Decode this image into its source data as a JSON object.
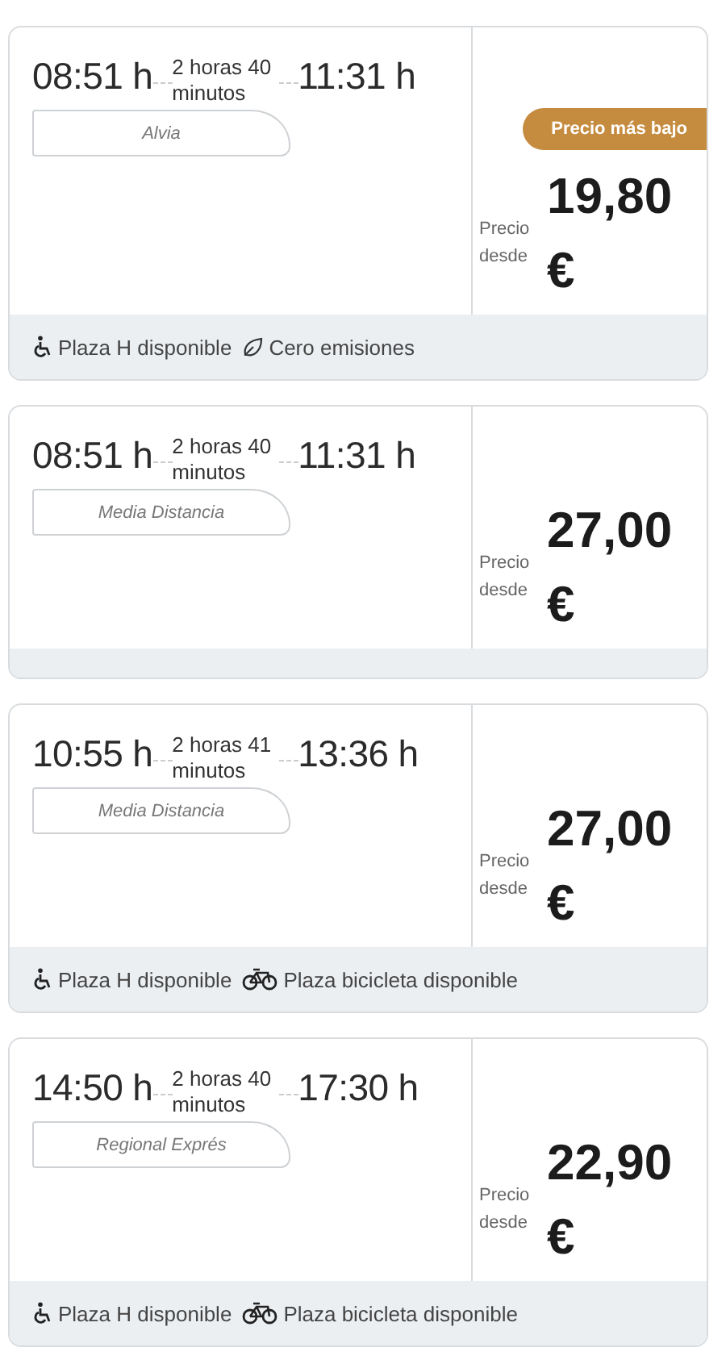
{
  "trips": [
    {
      "departure": "08:51 h",
      "duration": "2 horas 40 minutos",
      "arrival": "11:31 h",
      "train": "Alvia",
      "badge": "Precio más bajo",
      "price_label": "Precio desde",
      "price": "19,80 €",
      "features": [
        {
          "kind": "wheelchair",
          "label": "Plaza H disponible"
        },
        {
          "kind": "leaf",
          "label": "Cero emisiones"
        }
      ]
    },
    {
      "departure": "08:51 h",
      "duration": "2 horas 40 minutos",
      "arrival": "11:31 h",
      "train": "Media Distancia",
      "price_label": "Precio desde",
      "price": "27,00 €"
    },
    {
      "departure": "10:55 h",
      "duration": "2 horas 41 minutos",
      "arrival": "13:36 h",
      "train": "Media Distancia",
      "price_label": "Precio desde",
      "price": "27,00 €",
      "features": [
        {
          "kind": "wheelchair",
          "label": "Plaza H disponible"
        },
        {
          "kind": "bicycle",
          "label": "Plaza bicicleta disponible"
        }
      ]
    },
    {
      "departure": "14:50 h",
      "duration": "2 horas 40 minutos",
      "arrival": "17:30 h",
      "train": "Regional Exprés",
      "price_label": "Precio desde",
      "price": "22,90 €",
      "features": [
        {
          "kind": "wheelchair",
          "label": "Plaza H disponible"
        },
        {
          "kind": "bicycle",
          "label": "Plaza bicicleta disponible"
        }
      ]
    }
  ]
}
